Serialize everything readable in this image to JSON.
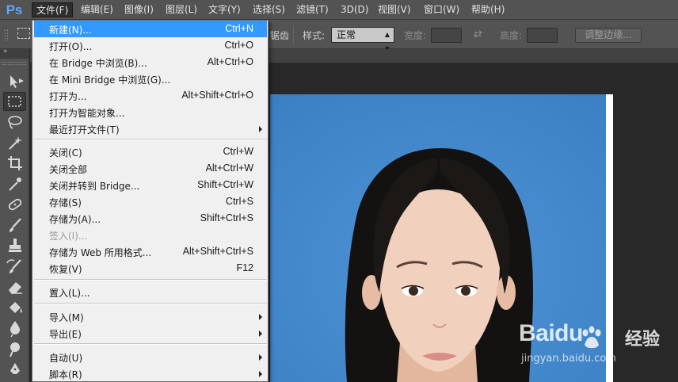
{
  "app": {
    "logo": "Ps"
  },
  "menubar": [
    {
      "label": "文件(F)",
      "active": true
    },
    {
      "label": "编辑(E)"
    },
    {
      "label": "图像(I)"
    },
    {
      "label": "图层(L)"
    },
    {
      "label": "文字(Y)"
    },
    {
      "label": "选择(S)"
    },
    {
      "label": "滤镜(T)"
    },
    {
      "label": "3D(D)"
    },
    {
      "label": "视图(V)"
    },
    {
      "label": "窗口(W)"
    },
    {
      "label": "帮助(H)"
    }
  ],
  "options_bar": {
    "partial_label": "锯齿",
    "style_label": "样式:",
    "style_value": "正常",
    "width_label": "宽度:",
    "height_label": "高度:",
    "refine_edge_button": "调整边缘..."
  },
  "file_menu": {
    "groups": [
      [
        {
          "label": "新建(N)...",
          "shortcut": "Ctrl+N",
          "highlighted": true
        },
        {
          "label": "打开(O)...",
          "shortcut": "Ctrl+O"
        },
        {
          "label": "在 Bridge 中浏览(B)...",
          "shortcut": "Alt+Ctrl+O"
        },
        {
          "label": "在 Mini Bridge 中浏览(G)...",
          "shortcut": ""
        },
        {
          "label": "打开为...",
          "shortcut": "Alt+Shift+Ctrl+O"
        },
        {
          "label": "打开为智能对象...",
          "shortcut": ""
        },
        {
          "label": "最近打开文件(T)",
          "shortcut": "",
          "submenu": true
        }
      ],
      [
        {
          "label": "关闭(C)",
          "shortcut": "Ctrl+W"
        },
        {
          "label": "关闭全部",
          "shortcut": "Alt+Ctrl+W"
        },
        {
          "label": "关闭并转到 Bridge...",
          "shortcut": "Shift+Ctrl+W"
        },
        {
          "label": "存储(S)",
          "shortcut": "Ctrl+S"
        },
        {
          "label": "存储为(A)...",
          "shortcut": "Shift+Ctrl+S"
        },
        {
          "label": "签入(I)...",
          "shortcut": "",
          "disabled": true
        },
        {
          "label": "存储为 Web 所用格式...",
          "shortcut": "Alt+Shift+Ctrl+S"
        },
        {
          "label": "恢复(V)",
          "shortcut": "F12"
        }
      ],
      [
        {
          "label": "置入(L)...",
          "shortcut": ""
        }
      ],
      [
        {
          "label": "导入(M)",
          "shortcut": "",
          "submenu": true
        },
        {
          "label": "导出(E)",
          "shortcut": "",
          "submenu": true
        }
      ],
      [
        {
          "label": "自动(U)",
          "shortcut": "",
          "submenu": true
        },
        {
          "label": "脚本(R)",
          "shortcut": "",
          "submenu": true
        }
      ]
    ]
  },
  "tools": [
    {
      "icon": "move-tool-icon"
    },
    {
      "icon": "rectangular-marquee-tool-icon",
      "active": true
    },
    {
      "icon": "lasso-tool-icon"
    },
    {
      "icon": "magic-wand-tool-icon"
    },
    {
      "icon": "crop-tool-icon"
    },
    {
      "icon": "eyedropper-tool-icon"
    },
    {
      "icon": "spot-healing-brush-icon"
    },
    {
      "icon": "brush-tool-icon"
    },
    {
      "icon": "clone-stamp-tool-icon"
    },
    {
      "icon": "history-brush-icon"
    },
    {
      "icon": "eraser-tool-icon"
    },
    {
      "icon": "paint-bucket-icon"
    },
    {
      "icon": "blur-tool-icon"
    },
    {
      "icon": "dodge-tool-icon"
    },
    {
      "icon": "pen-tool-icon"
    }
  ],
  "watermark": {
    "logo": "Baidu",
    "suffix": "经验",
    "url": "jingyan.baidu.com"
  },
  "colors": {
    "menubar_bg": "#535353",
    "menu_highlight": "#3399ff",
    "photo_background": "#3e86c9",
    "workspace": "#282828"
  }
}
